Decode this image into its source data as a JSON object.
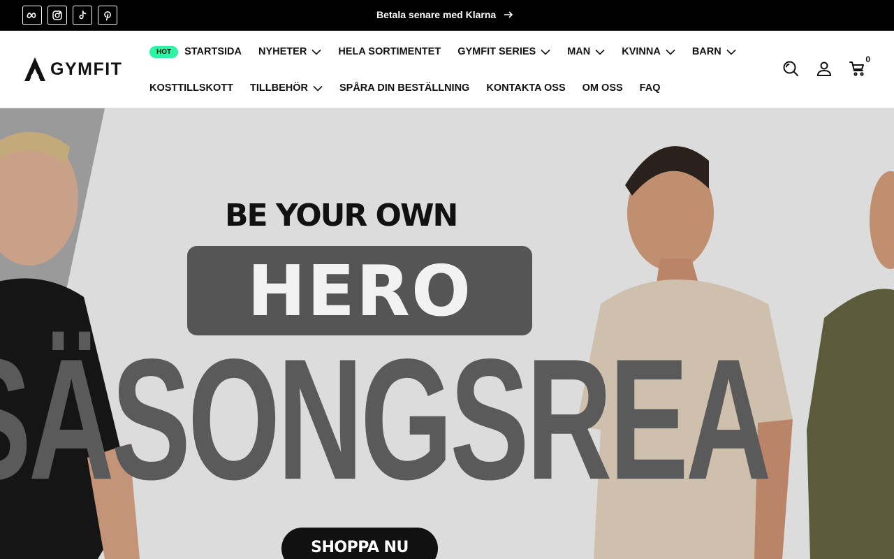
{
  "announcement": {
    "text": "Betala senare med Klarna"
  },
  "social": [
    {
      "icon": "meta-icon"
    },
    {
      "icon": "instagram-icon"
    },
    {
      "icon": "tiktok-icon"
    },
    {
      "icon": "pinterest-icon"
    }
  ],
  "logo": {
    "text": "GYMFIT"
  },
  "nav": {
    "hot_badge": "HOT",
    "row1": [
      {
        "label": "STARTSIDA"
      },
      {
        "label": "NYHETER",
        "dropdown": true
      },
      {
        "label": "HELA SORTIMENTET"
      },
      {
        "label": "GYMFIT SERIES",
        "dropdown": true
      },
      {
        "label": "MAN",
        "dropdown": true
      },
      {
        "label": "KVINNA",
        "dropdown": true
      },
      {
        "label": "BARN",
        "dropdown": true
      }
    ],
    "row2": [
      {
        "label": "KOSTTILLSKOTT"
      },
      {
        "label": "TILLBEHÖR",
        "dropdown": true
      },
      {
        "label": "SPÅRA DIN BESTÄLLNING"
      },
      {
        "label": "KONTAKTA OSS"
      },
      {
        "label": "OM OSS"
      },
      {
        "label": "FAQ"
      }
    ]
  },
  "cart": {
    "count": "0"
  },
  "hero": {
    "line1": "BE YOUR OWN",
    "line2": "HERO",
    "line3": "SÄSONGSREA",
    "cta": "SHOPPA NU"
  },
  "colors": {
    "topbar": "#000000",
    "hot_badge": "#2bf5a4",
    "hero_bg": "#dcdcdc",
    "hero_box": "#555555"
  }
}
